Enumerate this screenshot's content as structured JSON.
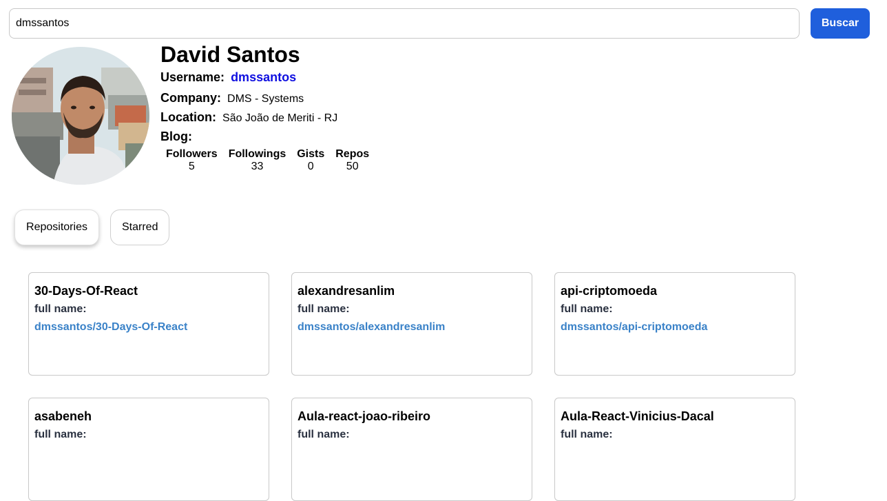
{
  "search": {
    "value": "dmssantos",
    "button_label": "Buscar"
  },
  "profile": {
    "name": "David Santos",
    "username_label": "Username:",
    "username": "dmssantos",
    "company_label": "Company:",
    "company": "DMS - Systems",
    "location_label": "Location:",
    "location": "São João de Meriti - RJ",
    "blog_label": "Blog:",
    "blog": ""
  },
  "stats": [
    {
      "label": "Followers",
      "value": "5"
    },
    {
      "label": "Followings",
      "value": "33"
    },
    {
      "label": "Gists",
      "value": "0"
    },
    {
      "label": "Repos",
      "value": "50"
    }
  ],
  "tabs": [
    {
      "label": "Repositories",
      "active": true
    },
    {
      "label": "Starred",
      "active": false
    }
  ],
  "full_name_label": "full name:",
  "repos": [
    {
      "name": "30-Days-Of-React",
      "full_name": "dmssantos/30-Days-Of-React"
    },
    {
      "name": "alexandresanlim",
      "full_name": "dmssantos/alexandresanlim"
    },
    {
      "name": "api-criptomoeda",
      "full_name": "dmssantos/api-criptomoeda"
    },
    {
      "name": "asabeneh",
      "full_name": ""
    },
    {
      "name": "Aula-react-joao-ribeiro",
      "full_name": ""
    },
    {
      "name": "Aula-React-Vinicius-Dacal",
      "full_name": ""
    }
  ],
  "colors": {
    "primary_button": "#1f5fdc",
    "username_link": "#1010e0",
    "repo_link": "#3a82c8"
  }
}
